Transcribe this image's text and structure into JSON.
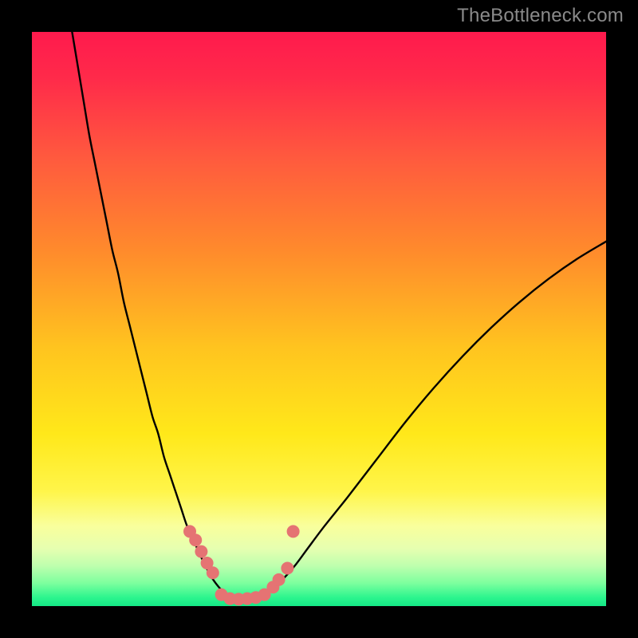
{
  "watermark": "TheBottleneck.com",
  "chart_data": {
    "type": "line",
    "title": "",
    "xlabel": "",
    "ylabel": "",
    "xlim": [
      0,
      100
    ],
    "ylim": [
      0,
      100
    ],
    "background_gradient_stops": [
      {
        "offset": 0.0,
        "color": "#ff1a4d"
      },
      {
        "offset": 0.08,
        "color": "#ff2a4a"
      },
      {
        "offset": 0.22,
        "color": "#ff5a3e"
      },
      {
        "offset": 0.38,
        "color": "#ff8a2c"
      },
      {
        "offset": 0.55,
        "color": "#ffc41f"
      },
      {
        "offset": 0.7,
        "color": "#ffe81a"
      },
      {
        "offset": 0.8,
        "color": "#fff54a"
      },
      {
        "offset": 0.86,
        "color": "#f9ff9c"
      },
      {
        "offset": 0.9,
        "color": "#e6ffb0"
      },
      {
        "offset": 0.93,
        "color": "#beffae"
      },
      {
        "offset": 0.96,
        "color": "#7dff9e"
      },
      {
        "offset": 0.985,
        "color": "#2cf58e"
      },
      {
        "offset": 1.0,
        "color": "#14e886"
      }
    ],
    "series": [
      {
        "name": "bottleneck-curve",
        "color": "#000000",
        "stroke_width": 2.4,
        "x": [
          7,
          8,
          9,
          10,
          11,
          12,
          13,
          14,
          15,
          16,
          17,
          18,
          19,
          20,
          21,
          22,
          23,
          24,
          25,
          26,
          27,
          28,
          29,
          30,
          31,
          32,
          33,
          34,
          35,
          36,
          38,
          40,
          42,
          44,
          46,
          48,
          51,
          55,
          60,
          65,
          70,
          75,
          80,
          85,
          90,
          95,
          100
        ],
        "y": [
          100,
          94,
          88,
          82,
          77,
          72,
          67,
          62,
          58,
          53,
          49,
          45,
          41,
          37,
          33,
          30,
          26,
          23,
          20,
          17,
          14,
          12,
          9.5,
          7.5,
          5.5,
          4,
          2.8,
          1.8,
          1.1,
          0.7,
          0.8,
          1.7,
          3.2,
          5,
          7.3,
          10,
          14,
          19,
          25.5,
          32,
          38,
          43.5,
          48.5,
          53,
          57,
          60.5,
          63.5
        ]
      },
      {
        "name": "highlight-markers",
        "color": "#e57373",
        "marker_radius": 8,
        "points": [
          {
            "x": 27.5,
            "y": 13
          },
          {
            "x": 28.5,
            "y": 11.5
          },
          {
            "x": 29.5,
            "y": 9.5
          },
          {
            "x": 30.5,
            "y": 7.5
          },
          {
            "x": 31.5,
            "y": 5.8
          },
          {
            "x": 33.0,
            "y": 2.0
          },
          {
            "x": 34.5,
            "y": 1.3
          },
          {
            "x": 36.0,
            "y": 1.2
          },
          {
            "x": 37.5,
            "y": 1.3
          },
          {
            "x": 39.0,
            "y": 1.5
          },
          {
            "x": 40.5,
            "y": 2.0
          },
          {
            "x": 42.0,
            "y": 3.3
          },
          {
            "x": 43.0,
            "y": 4.6
          },
          {
            "x": 44.5,
            "y": 6.6
          },
          {
            "x": 45.5,
            "y": 13.0
          }
        ]
      }
    ]
  }
}
